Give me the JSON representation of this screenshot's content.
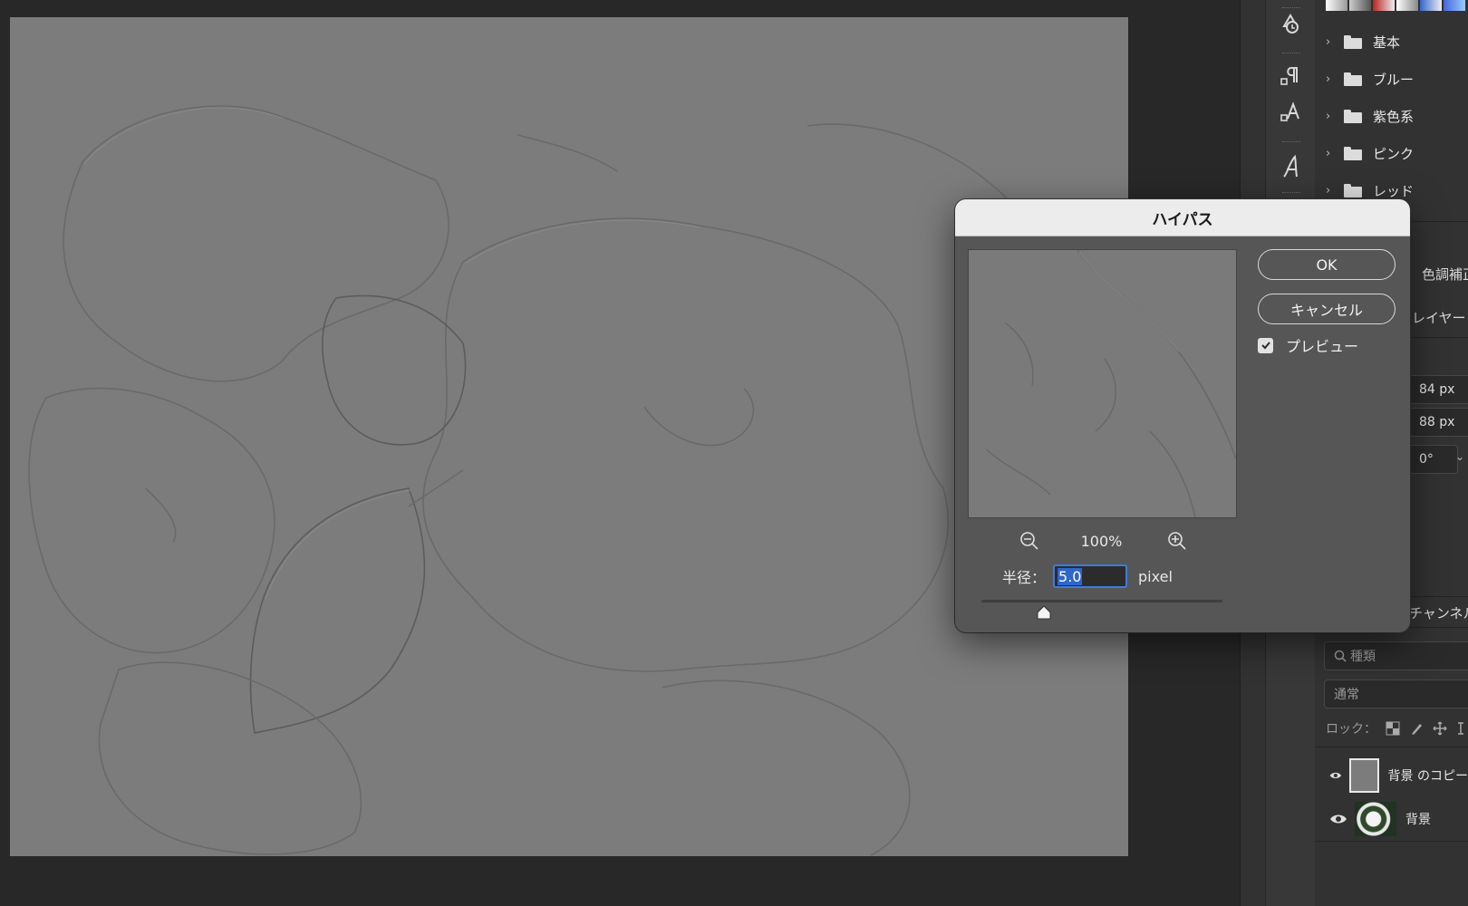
{
  "dialog": {
    "title": "ハイパス",
    "ok_label": "OK",
    "cancel_label": "キャンセル",
    "preview_label": "プレビュー",
    "preview_checked": true,
    "zoom": "100%",
    "radius_label": "半径：",
    "radius_value": "5.0",
    "radius_unit": "pixel",
    "radius_slider_fraction": 0.26
  },
  "swatch_presets": {
    "folders": [
      {
        "label": "基本"
      },
      {
        "label": "ブルー"
      },
      {
        "label": "紫色系"
      },
      {
        "label": "ピンク"
      },
      {
        "label": "レッド"
      }
    ]
  },
  "properties_panel": {
    "adjust_tab": "色調補正",
    "layer_label": "レイヤー",
    "width_value": "84 px",
    "height_value": "88 px",
    "angle_value": "0°"
  },
  "layers_panel": {
    "channels_tab": "チャンネル",
    "search_placeholder": "種類",
    "blend_mode": "通常",
    "lock_label": "ロック：",
    "layers": [
      {
        "name": "背景 のコピー",
        "visible": true,
        "selected": false
      },
      {
        "name": "背景",
        "visible": true,
        "selected": false
      }
    ]
  },
  "tools": [
    {
      "icon": "history-brush-icon"
    },
    {
      "icon": "paragraph-icon"
    },
    {
      "icon": "character-style-icon"
    },
    {
      "icon": "glyphs-icon"
    }
  ],
  "colors": {
    "canvas": "#7c7c7c",
    "accent": "#3b7de0",
    "panel_bg": "#323232"
  }
}
